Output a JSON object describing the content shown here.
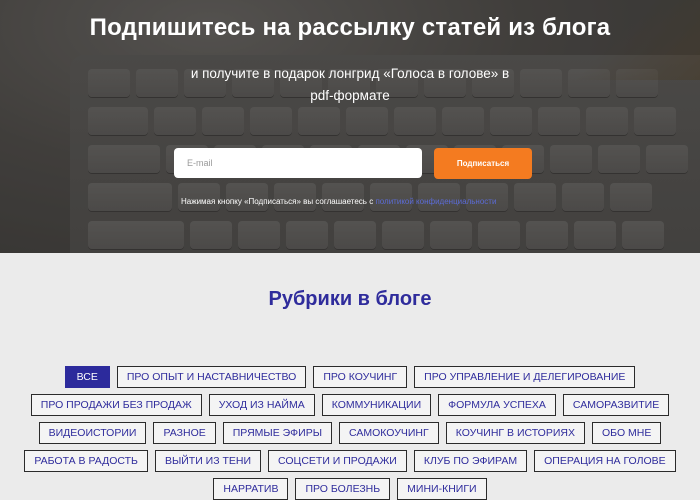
{
  "subscribe": {
    "title": "Подпишитесь на рассылку статей из блога",
    "subtitle": "и получите в подарок лонгрид «Голоса в голове» в pdf-формате",
    "email_placeholder": "E-mail",
    "button_label": "Подписаться",
    "consent_text": "Нажимая кнопку «Подписаться» вы соглашаетесь с",
    "consent_link": "политикой конфиденциальности"
  },
  "rubrics": {
    "title": "Рубрики в блоге",
    "active": "ВСЕ",
    "rows": [
      [
        "ВСЕ",
        "ПРО ОПЫТ И НАСТАВНИЧЕСТВО",
        "ПРО КОУЧИНГ",
        "ПРО УПРАВЛЕНИЕ И ДЕЛЕГИРОВАНИЕ"
      ],
      [
        "ПРО ПРОДАЖИ БЕЗ ПРОДАЖ",
        "УХОД ИЗ НАЙМА",
        "КОММУНИКАЦИИ",
        "ФОРМУЛА УСПЕХА",
        "САМОРАЗВИТИЕ"
      ],
      [
        "ВИДЕОИСТОРИИ",
        "РАЗНОЕ",
        "ПРЯМЫЕ ЭФИРЫ",
        "САМОКОУЧИНГ",
        "КОУЧИНГ В ИСТОРИЯХ",
        "ОБО МНЕ"
      ],
      [
        "РАБОТА В РАДОСТЬ",
        "ВЫЙТИ ИЗ ТЕНИ",
        "СОЦСЕТИ И ПРОДАЖИ",
        "КЛУБ ПО ЭФИРАМ",
        "ОПЕРАЦИЯ НА ГОЛОВЕ"
      ],
      [
        "НАРРАТИВ",
        "ПРО БОЛЕЗНЬ",
        "МИНИ-КНИГИ"
      ]
    ]
  },
  "colors": {
    "accent_orange": "#f47b20",
    "heading_blue": "#2f2c9c",
    "page_bg": "#ebebeb"
  }
}
